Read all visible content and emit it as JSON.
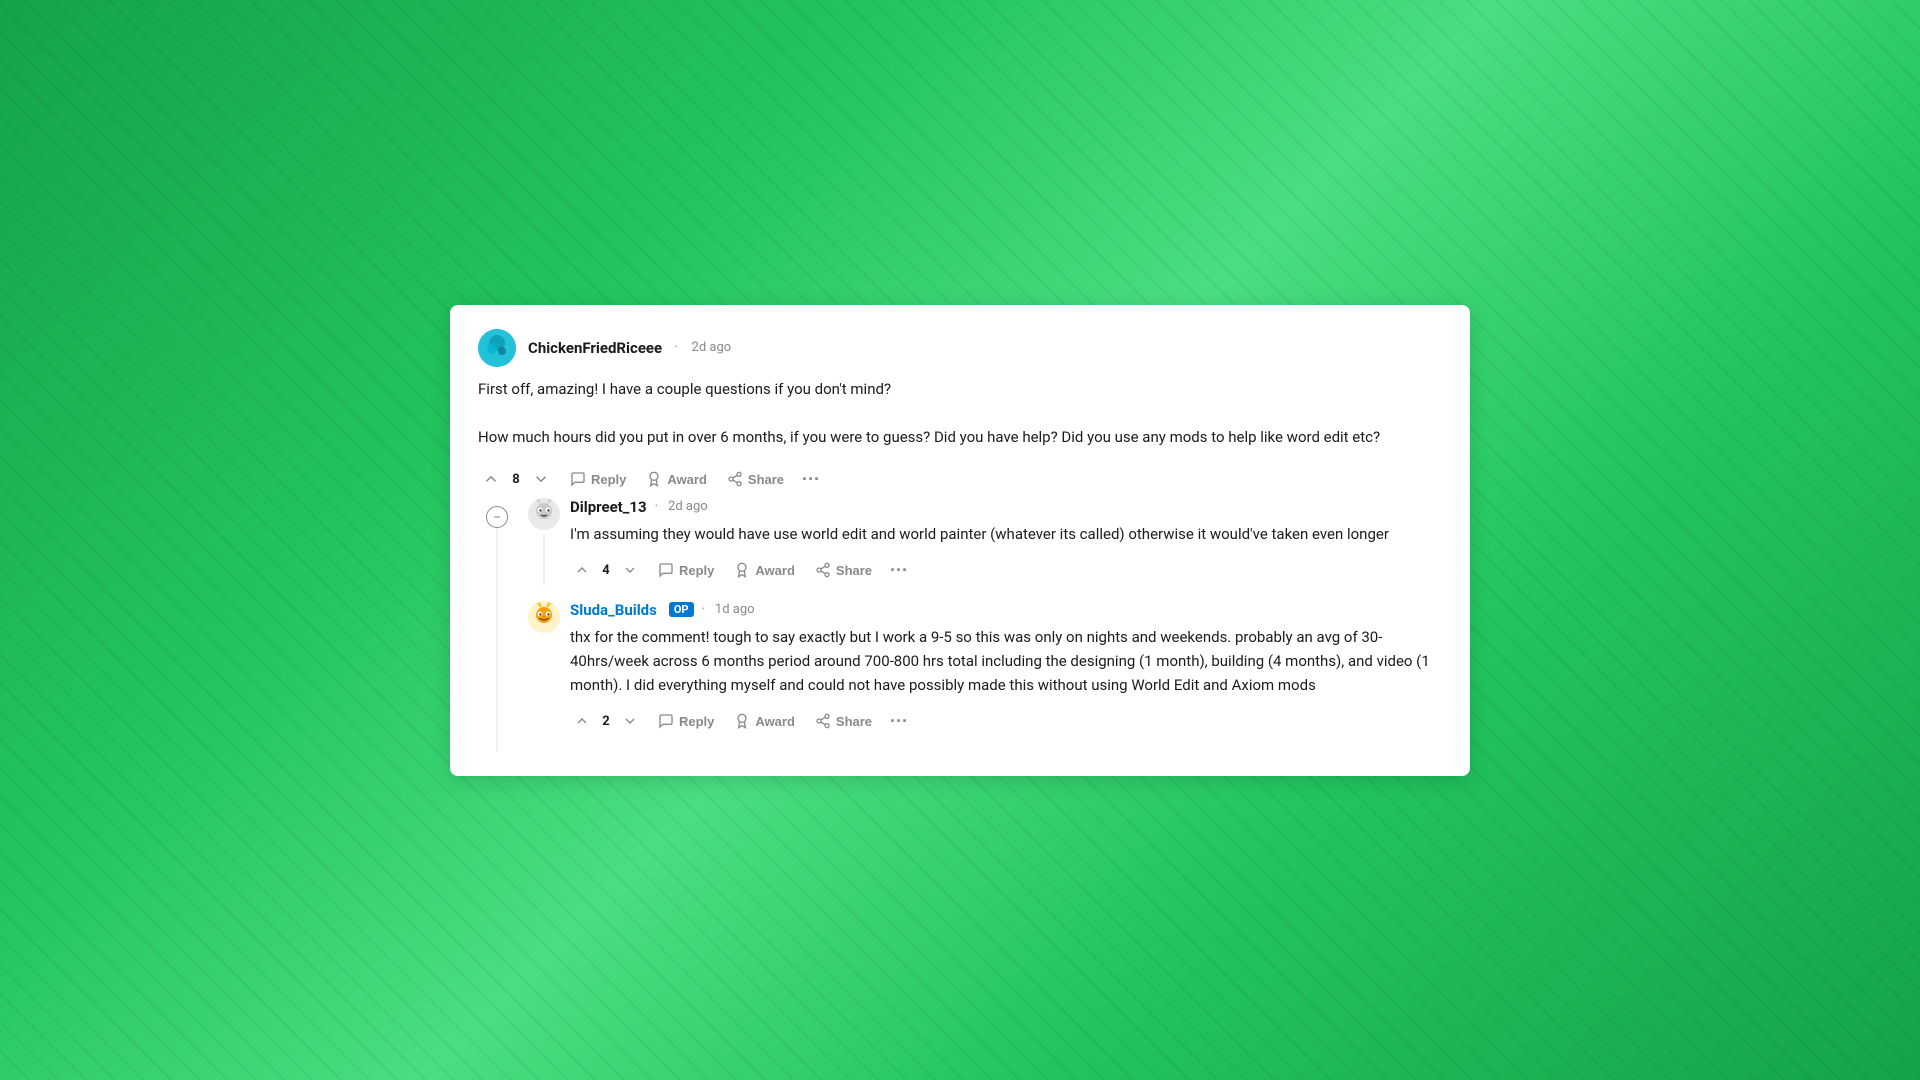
{
  "background": "#22c55e",
  "comments": {
    "main": {
      "username": "ChickenFriedRiceee",
      "timestamp": "2d ago",
      "body_line1": "First off, amazing! I have a couple questions if you don't mind?",
      "body_line2": "How much hours did you put in over 6 months, if you were to guess? Did you have help? Did you use any mods to help like word edit etc?",
      "vote_count": "8",
      "actions": {
        "reply": "Reply",
        "award": "Award",
        "share": "Share"
      }
    },
    "reply1": {
      "username": "Dilpreet_13",
      "timestamp": "2d ago",
      "body": "I'm assuming they would have use world edit and world painter (whatever its called) otherwise it would've taken even longer",
      "vote_count": "4",
      "actions": {
        "reply": "Reply",
        "award": "Award",
        "share": "Share"
      }
    },
    "reply2": {
      "username": "Sluda_Builds",
      "op_badge": "OP",
      "timestamp": "1d ago",
      "body": "thx for the comment! tough to say exactly but I work a 9-5 so this was only on nights and weekends. probably an avg of 30-40hrs/week across 6 months period around 700-800 hrs total including the designing (1 month), building (4 months), and video (1 month). I did everything myself and could not have possibly made this without using World Edit and Axiom mods",
      "vote_count": "2",
      "actions": {
        "reply": "Reply",
        "award": "Award",
        "share": "Share"
      }
    }
  }
}
